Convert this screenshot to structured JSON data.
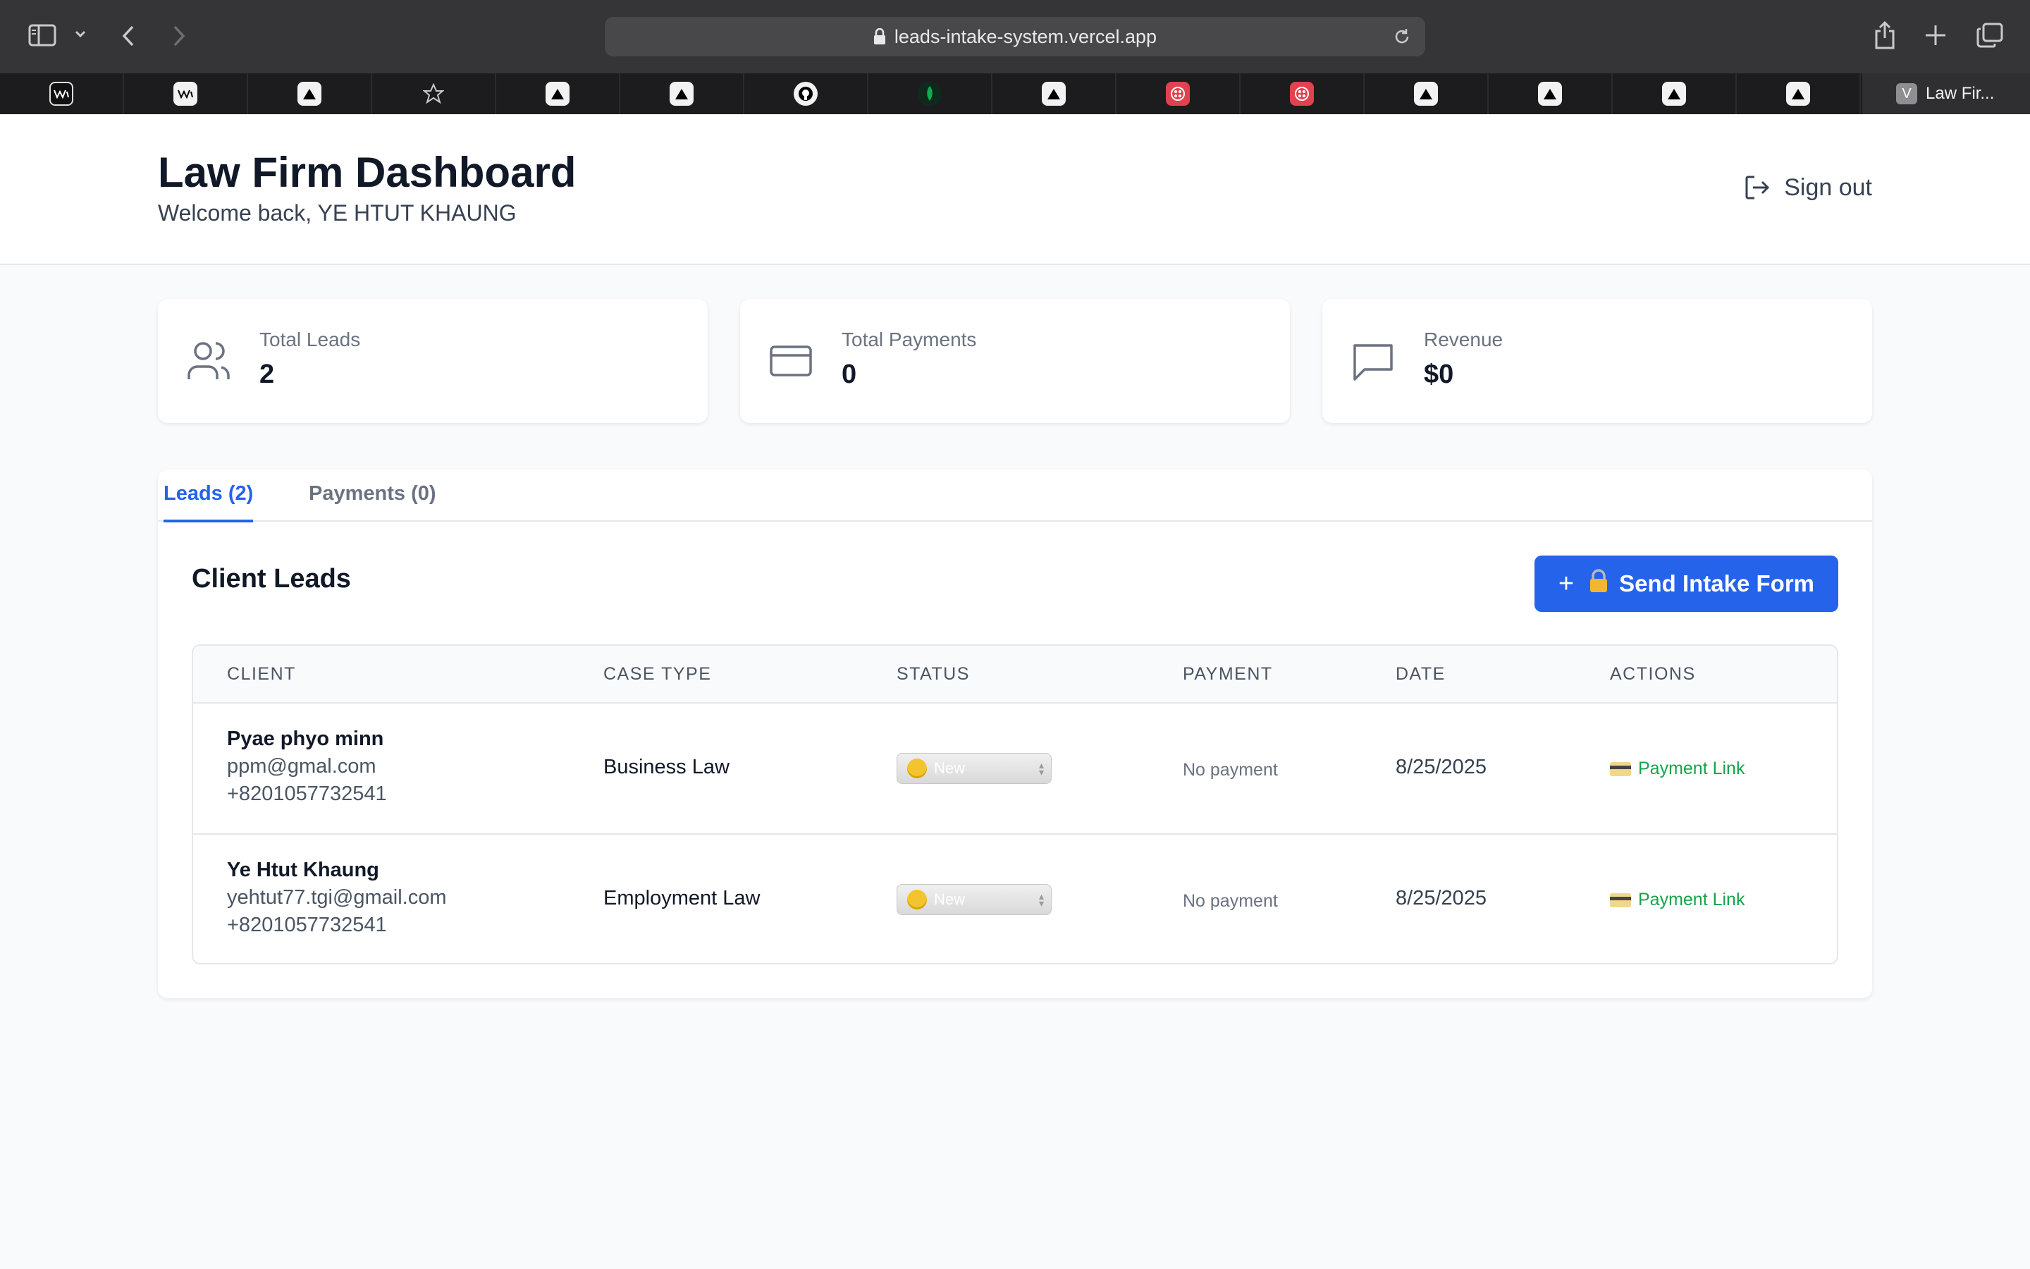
{
  "browser": {
    "url": "leads-intake-system.vercel.app",
    "active_tab_title": "Law Fir...",
    "active_tab_favicon_letter": "V",
    "pinned_tabs": [
      "wix-icon",
      "wix-icon",
      "vercel-icon",
      "star-icon",
      "vercel-icon",
      "vercel-icon",
      "github-icon",
      "mongodb-icon",
      "vercel-icon",
      "twilio-icon",
      "twilio-icon",
      "vercel-icon",
      "vercel-icon",
      "vercel-icon",
      "vercel-icon"
    ]
  },
  "header": {
    "title": "Law Firm Dashboard",
    "welcome": "Welcome back, YE HTUT KHAUNG",
    "sign_out": "Sign out"
  },
  "stats": [
    {
      "label": "Total Leads",
      "value": "2",
      "icon": "users-icon"
    },
    {
      "label": "Total Payments",
      "value": "0",
      "icon": "credit-card-icon"
    },
    {
      "label": "Revenue",
      "value": "$0",
      "icon": "message-icon"
    }
  ],
  "tabs": [
    {
      "label": "Leads (2)",
      "active": true
    },
    {
      "label": "Payments (0)",
      "active": false
    }
  ],
  "leads": {
    "title": "Client Leads",
    "send_button": "Send Intake Form",
    "columns": [
      "CLIENT",
      "CASE TYPE",
      "STATUS",
      "PAYMENT",
      "DATE",
      "ACTIONS"
    ],
    "rows": [
      {
        "name": "Pyae phyo minn",
        "email": "ppm@gmal.com",
        "phone": "+8201057732541",
        "case_type": "Business Law",
        "status": "New",
        "payment": "No payment",
        "date": "8/25/2025",
        "action": "Payment Link"
      },
      {
        "name": "Ye Htut Khaung",
        "email": "yehtut77.tgi@gmail.com",
        "phone": "+8201057732541",
        "case_type": "Employment Law",
        "status": "New",
        "payment": "No payment",
        "date": "8/25/2025",
        "action": "Payment Link"
      }
    ]
  },
  "colors": {
    "primary": "#2563eb",
    "success": "#16a34a",
    "background": "#f9fafb"
  }
}
